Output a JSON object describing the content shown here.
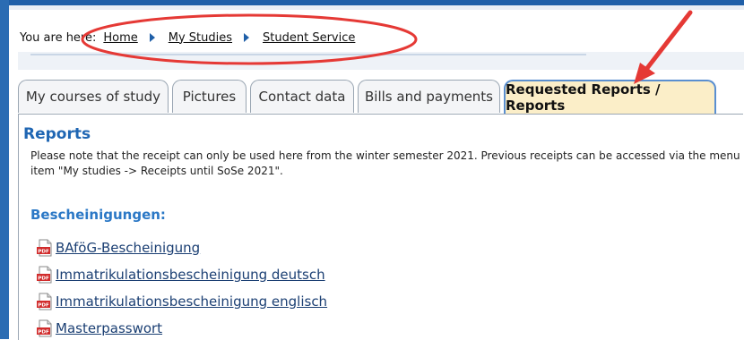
{
  "breadcrumb": {
    "lead": "You are here:",
    "items": [
      "Home",
      "My Studies",
      "Student Service"
    ]
  },
  "tabs": [
    {
      "label": "My courses of study",
      "active": false
    },
    {
      "label": "Pictures",
      "active": false
    },
    {
      "label": "Contact data",
      "active": false
    },
    {
      "label": "Bills and payments",
      "active": false
    },
    {
      "label": "Requested Reports / Reports",
      "active": true
    }
  ],
  "content": {
    "title": "Reports",
    "notice": "Please note that the receipt can only be used here from the winter semester 2021. Previous receipts can be accessed via the menu item \"My studies -> Receipts until SoSe 2021\".",
    "section_title": "Bescheinigungen:",
    "documents": [
      "BAföG-Bescheinigung",
      "Immatrikulationsbescheinigung deutsch",
      "Immatrikulationsbescheinigung englisch",
      "Masterpasswort"
    ]
  },
  "icons": {
    "pdf": "pdf-file-icon",
    "breadcrumb_separator": "chevron-right-icon"
  },
  "colors": {
    "accent": "#1f66b3",
    "active_tab_bg": "#fbeec8",
    "annotation_red": "#e53935"
  }
}
